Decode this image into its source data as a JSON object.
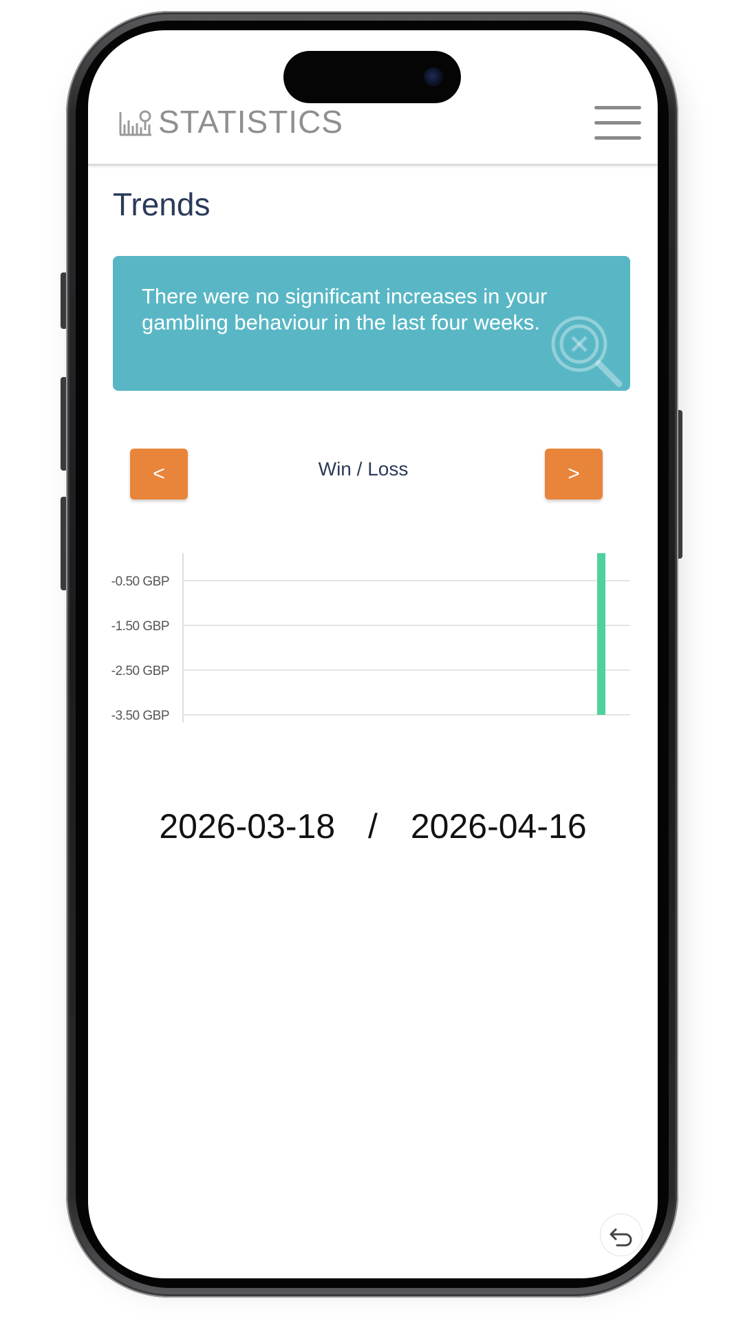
{
  "header": {
    "title": "STATISTICS",
    "logo_icon": "statistics-icon",
    "menu_icon": "hamburger-menu-icon"
  },
  "page": {
    "heading": "Trends"
  },
  "alert": {
    "message": "There were no significant increases in your gambling behaviour in the last four weeks.",
    "icon": "search-x-icon",
    "background": "#59b7c5"
  },
  "chart_nav": {
    "prev_label": "<",
    "next_label": ">",
    "chart_title": "Win / Loss",
    "button_color": "#e8853a"
  },
  "chart_data": {
    "type": "bar",
    "yticks": [
      "-0.50 GBP",
      "-1.50 GBP",
      "-2.50 GBP",
      "-3.50 GBP"
    ],
    "ylim": [
      -3.5,
      0.0
    ],
    "grid": true,
    "x": [
      "2026-03-18",
      "2026-04-16"
    ],
    "series": [
      {
        "color": "#4fd19e",
        "points": [
          {
            "x": "2026-04-16",
            "value": -3.5
          }
        ]
      }
    ]
  },
  "date_range": {
    "start": "2026-03-18",
    "separator": "/",
    "end": "2026-04-16"
  },
  "footer": {
    "back_icon": "back-arrow-icon"
  }
}
